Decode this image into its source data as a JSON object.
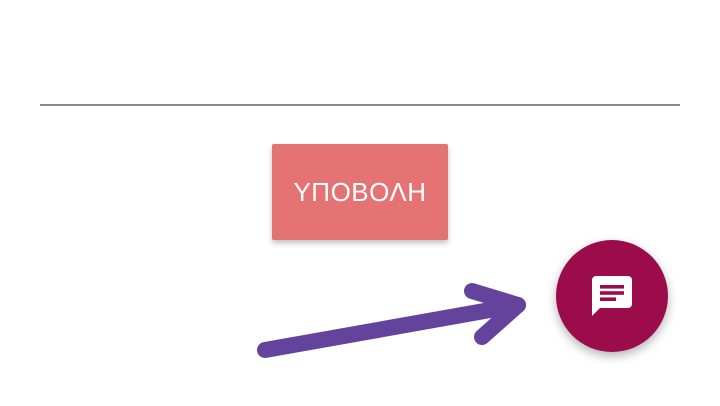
{
  "main": {
    "submit_label": "ΥΠΟΒΟΛΗ"
  },
  "fab": {
    "icon": "chat-message-icon"
  },
  "annotation": {
    "icon": "arrow-annotation"
  },
  "colors": {
    "submit_button": "#e57373",
    "fab": "#9c0b4a",
    "arrow": "#63439b",
    "divider": "#8a8a8a"
  }
}
